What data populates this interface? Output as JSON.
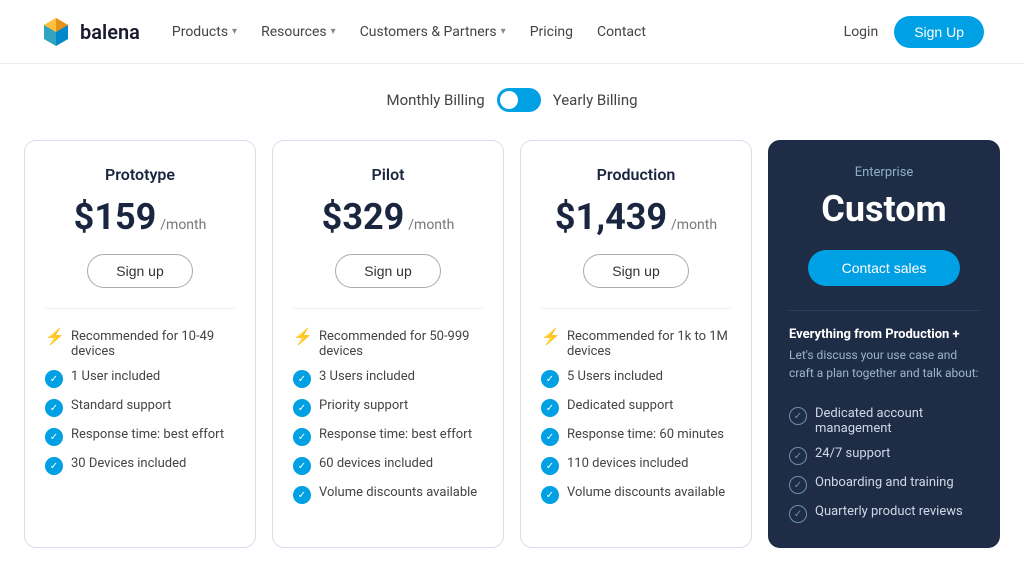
{
  "nav": {
    "logo_text": "balena",
    "links": [
      {
        "label": "Products",
        "has_dropdown": true
      },
      {
        "label": "Resources",
        "has_dropdown": true
      },
      {
        "label": "Customers & Partners",
        "has_dropdown": true
      },
      {
        "label": "Pricing",
        "has_dropdown": false
      },
      {
        "label": "Contact",
        "has_dropdown": false
      }
    ],
    "login_label": "Login",
    "signup_label": "Sign Up"
  },
  "billing": {
    "monthly_label": "Monthly Billing",
    "yearly_label": "Yearly Billing"
  },
  "plans": [
    {
      "id": "prototype",
      "name": "Prototype",
      "price": "$159",
      "period": "/month",
      "signup_label": "Sign up",
      "features": [
        {
          "icon": "lightning",
          "text": "Recommended for 10-49 devices"
        },
        {
          "icon": "check",
          "text": "1 User included"
        },
        {
          "icon": "check",
          "text": "Standard support"
        },
        {
          "icon": "check",
          "text": "Response time: best effort"
        },
        {
          "icon": "check",
          "text": "30 Devices included"
        }
      ]
    },
    {
      "id": "pilot",
      "name": "Pilot",
      "price": "$329",
      "period": "/month",
      "signup_label": "Sign up",
      "features": [
        {
          "icon": "lightning",
          "text": "Recommended for 50-999 devices"
        },
        {
          "icon": "check",
          "text": "3 Users included"
        },
        {
          "icon": "check",
          "text": "Priority support"
        },
        {
          "icon": "check",
          "text": "Response time: best effort"
        },
        {
          "icon": "check",
          "text": "60 devices included"
        },
        {
          "icon": "check",
          "text": "Volume discounts available"
        }
      ]
    },
    {
      "id": "production",
      "name": "Production",
      "price": "$1,439",
      "period": "/month",
      "signup_label": "Sign up",
      "features": [
        {
          "icon": "lightning",
          "text": "Recommended for 1k to 1M devices"
        },
        {
          "icon": "check",
          "text": "5 Users included"
        },
        {
          "icon": "check",
          "text": "Dedicated support"
        },
        {
          "icon": "check",
          "text": "Response time: 60 minutes"
        },
        {
          "icon": "check",
          "text": "110 devices included"
        },
        {
          "icon": "check",
          "text": "Volume discounts available"
        }
      ]
    },
    {
      "id": "enterprise",
      "name": "Enterprise",
      "custom_label": "Custom",
      "contact_label": "Contact sales",
      "everything_from": "Everything from Production +",
      "everything_desc": "Let's discuss your use case and craft a plan together and talk about:",
      "features": [
        {
          "text": "Dedicated account management"
        },
        {
          "text": "24/7 support"
        },
        {
          "text": "Onboarding and training"
        },
        {
          "text": "Quarterly product reviews"
        }
      ]
    }
  ]
}
